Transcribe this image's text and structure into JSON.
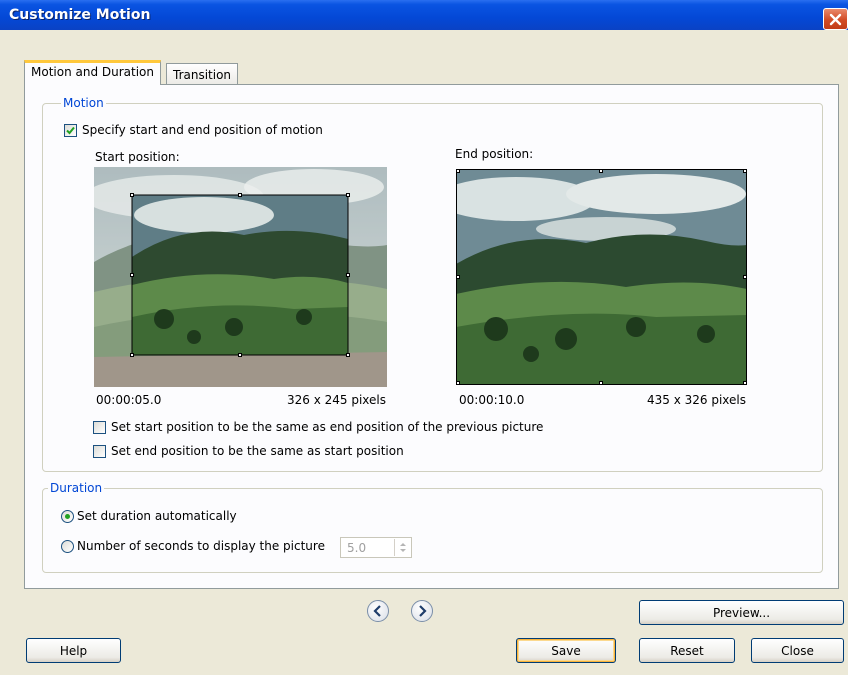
{
  "window": {
    "title": "Customize Motion"
  },
  "tabs": [
    {
      "label": "Motion and Duration",
      "active": true
    },
    {
      "label": "Transition",
      "active": false
    }
  ],
  "motion": {
    "group_label": "Motion",
    "specify_checkbox": {
      "label": "Specify start and end position of motion",
      "checked": true
    },
    "start": {
      "label": "Start position:",
      "time": "00:00:05.0",
      "size": "326 x 245 pixels"
    },
    "end": {
      "label": "End position:",
      "time": "00:00:10.0",
      "size": "435 x 326 pixels"
    },
    "same_as_prev_checkbox": {
      "label": "Set start position to be the same as end position of the previous picture",
      "checked": false
    },
    "end_same_as_start_checkbox": {
      "label": "Set end position to be the same as start position",
      "checked": false
    }
  },
  "duration": {
    "group_label": "Duration",
    "auto_radio": {
      "label": "Set duration automatically",
      "selected": true
    },
    "seconds_radio": {
      "label": "Number of seconds to display the picture",
      "selected": false
    },
    "seconds_value": "5.0"
  },
  "buttons": {
    "preview": "Preview...",
    "help": "Help",
    "save": "Save",
    "reset": "Reset",
    "close": "Close"
  },
  "icons": {
    "close": "close-icon",
    "prev": "chevron-left-icon",
    "next": "chevron-right-icon",
    "check": "checkmark-icon"
  },
  "colors": {
    "title_bar": "#0448d6",
    "group_legend": "#0046d5",
    "dialog_bg": "#ece9d8"
  }
}
